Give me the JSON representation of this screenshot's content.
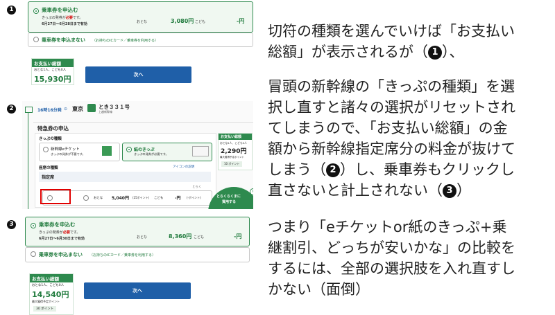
{
  "markers": {
    "m1": "1",
    "m2": "2",
    "m3": "3"
  },
  "panel1": {
    "opt1_title": "乗車券を申込む",
    "opt1_sub_a": "きっぷの発券が",
    "opt1_sub_red": "必要",
    "opt1_sub_b": "です。",
    "opt1_dates": "6月27日〜6月28日まで有効",
    "adult_label": "おとな",
    "adult_price": "3,080円",
    "child_label": "こども",
    "child_price": "-円",
    "opt2_title": "乗車券を申込まない",
    "opt2_note": "（お持ちのICカード／乗車券を利用する）",
    "total_head": "お支払い総額",
    "total_sub": "おとな1人、こども0人",
    "total_price": "15,930円",
    "next": "次へ"
  },
  "panel2": {
    "time": "16時16分発",
    "station": "東京",
    "train_name": "とき３３１号",
    "train_sub": "上越新幹線",
    "section_title": "特急券の申込",
    "kind_label": "きっぷの種類",
    "eticket_title": "新幹線eチケット",
    "eticket_sub": "きっぷの発券が不要です。",
    "paper_title": "紙のきっぷ",
    "paper_sub": "きっぷの発券が必要です。",
    "seat_label": "座席の種類",
    "icon_help": "アイコンの説明",
    "reserved": "指定席",
    "toraku": "とらく",
    "row_adult": "おとな",
    "row_adult_price": "5,040円",
    "row_points": "(25ポイント)",
    "row_child": "こども",
    "row_child_price": "-円",
    "row_child_points": "(-ポイント)",
    "side_head": "お支払い総額",
    "side_sub": "おとな1人、こども0人",
    "side_price": "2,290円",
    "side_points_label": "最大獲得予定ポイント",
    "side_points": "10 ポイント",
    "badge1": "とらくらくまに",
    "badge2": "買用する"
  },
  "panel3": {
    "opt1_title": "乗車券を申込む",
    "opt1_sub_a": "きっぷの発券が",
    "opt1_sub_red": "必要",
    "opt1_sub_b": "です。",
    "opt1_dates": "6月27日〜6月30日まで有効",
    "adult_label": "おとな",
    "adult_price": "8,360円",
    "child_label": "こども",
    "child_price": "-円",
    "opt2_title": "乗車券を申込まない",
    "opt2_note": "（お持ちのICカード／乗車券を利用する）",
    "total_head": "お支払い総額",
    "total_sub": "おとな1人、こども0人",
    "total_price": "14,540円",
    "points_label": "最大獲得予定ポイント",
    "points": "30 ポイント",
    "next": "次へ"
  },
  "text": {
    "p1_l1": "切符の種類を選んでいけば「お支払い",
    "p1_l2a": "総額」が表示されるが（",
    "p1_l2b": "）、",
    "p2_l1": "冒頭の新幹線の「きっぷの種類」を選",
    "p2_l2": "択し直すと諸々の選択がリセットされ",
    "p2_l3": "てしまうので、「お支払い総額」の金",
    "p2_l4": "額から新幹線指定席分の料金が抜けて",
    "p2_l5a": "しまう（",
    "p2_l5b": "）し、乗車券もクリックし",
    "p2_l6a": "直さないと計上されない（",
    "p2_l6b": "）",
    "p3_l1": "つまり「eチケットor紙のきっぷ+乗",
    "p3_l2": "継割引、どっちが安いかな」の比較を",
    "p3_l3": "するには、全部の選択肢を入れ直すし",
    "p3_l4": "かない（面倒）"
  },
  "colors": {
    "brand_green": "#2e8a4e",
    "next_blue": "#1f5fa8",
    "highlight_red": "#e00000"
  }
}
